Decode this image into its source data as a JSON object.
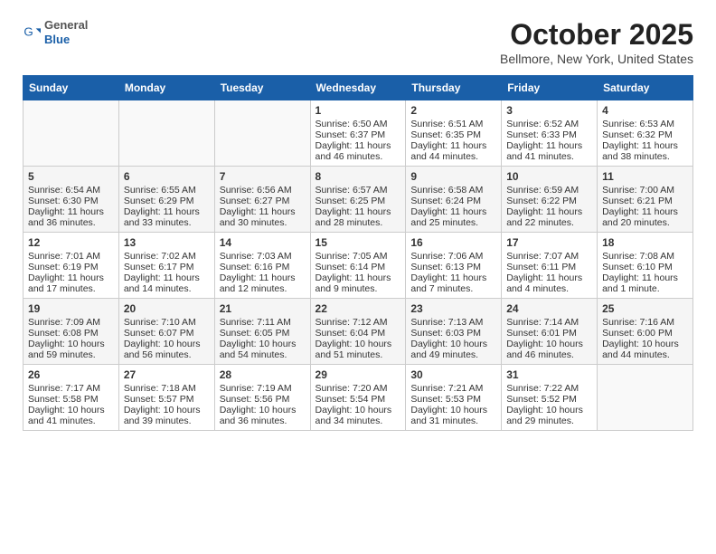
{
  "header": {
    "logo": {
      "general": "General",
      "blue": "Blue"
    },
    "title": "October 2025",
    "location": "Bellmore, New York, United States"
  },
  "days_of_week": [
    "Sunday",
    "Monday",
    "Tuesday",
    "Wednesday",
    "Thursday",
    "Friday",
    "Saturday"
  ],
  "weeks": [
    [
      {
        "day": "",
        "info": ""
      },
      {
        "day": "",
        "info": ""
      },
      {
        "day": "",
        "info": ""
      },
      {
        "day": "1",
        "info": "Sunrise: 6:50 AM\nSunset: 6:37 PM\nDaylight: 11 hours\nand 46 minutes."
      },
      {
        "day": "2",
        "info": "Sunrise: 6:51 AM\nSunset: 6:35 PM\nDaylight: 11 hours\nand 44 minutes."
      },
      {
        "day": "3",
        "info": "Sunrise: 6:52 AM\nSunset: 6:33 PM\nDaylight: 11 hours\nand 41 minutes."
      },
      {
        "day": "4",
        "info": "Sunrise: 6:53 AM\nSunset: 6:32 PM\nDaylight: 11 hours\nand 38 minutes."
      }
    ],
    [
      {
        "day": "5",
        "info": "Sunrise: 6:54 AM\nSunset: 6:30 PM\nDaylight: 11 hours\nand 36 minutes."
      },
      {
        "day": "6",
        "info": "Sunrise: 6:55 AM\nSunset: 6:29 PM\nDaylight: 11 hours\nand 33 minutes."
      },
      {
        "day": "7",
        "info": "Sunrise: 6:56 AM\nSunset: 6:27 PM\nDaylight: 11 hours\nand 30 minutes."
      },
      {
        "day": "8",
        "info": "Sunrise: 6:57 AM\nSunset: 6:25 PM\nDaylight: 11 hours\nand 28 minutes."
      },
      {
        "day": "9",
        "info": "Sunrise: 6:58 AM\nSunset: 6:24 PM\nDaylight: 11 hours\nand 25 minutes."
      },
      {
        "day": "10",
        "info": "Sunrise: 6:59 AM\nSunset: 6:22 PM\nDaylight: 11 hours\nand 22 minutes."
      },
      {
        "day": "11",
        "info": "Sunrise: 7:00 AM\nSunset: 6:21 PM\nDaylight: 11 hours\nand 20 minutes."
      }
    ],
    [
      {
        "day": "12",
        "info": "Sunrise: 7:01 AM\nSunset: 6:19 PM\nDaylight: 11 hours\nand 17 minutes."
      },
      {
        "day": "13",
        "info": "Sunrise: 7:02 AM\nSunset: 6:17 PM\nDaylight: 11 hours\nand 14 minutes."
      },
      {
        "day": "14",
        "info": "Sunrise: 7:03 AM\nSunset: 6:16 PM\nDaylight: 11 hours\nand 12 minutes."
      },
      {
        "day": "15",
        "info": "Sunrise: 7:05 AM\nSunset: 6:14 PM\nDaylight: 11 hours\nand 9 minutes."
      },
      {
        "day": "16",
        "info": "Sunrise: 7:06 AM\nSunset: 6:13 PM\nDaylight: 11 hours\nand 7 minutes."
      },
      {
        "day": "17",
        "info": "Sunrise: 7:07 AM\nSunset: 6:11 PM\nDaylight: 11 hours\nand 4 minutes."
      },
      {
        "day": "18",
        "info": "Sunrise: 7:08 AM\nSunset: 6:10 PM\nDaylight: 11 hours\nand 1 minute."
      }
    ],
    [
      {
        "day": "19",
        "info": "Sunrise: 7:09 AM\nSunset: 6:08 PM\nDaylight: 10 hours\nand 59 minutes."
      },
      {
        "day": "20",
        "info": "Sunrise: 7:10 AM\nSunset: 6:07 PM\nDaylight: 10 hours\nand 56 minutes."
      },
      {
        "day": "21",
        "info": "Sunrise: 7:11 AM\nSunset: 6:05 PM\nDaylight: 10 hours\nand 54 minutes."
      },
      {
        "day": "22",
        "info": "Sunrise: 7:12 AM\nSunset: 6:04 PM\nDaylight: 10 hours\nand 51 minutes."
      },
      {
        "day": "23",
        "info": "Sunrise: 7:13 AM\nSunset: 6:03 PM\nDaylight: 10 hours\nand 49 minutes."
      },
      {
        "day": "24",
        "info": "Sunrise: 7:14 AM\nSunset: 6:01 PM\nDaylight: 10 hours\nand 46 minutes."
      },
      {
        "day": "25",
        "info": "Sunrise: 7:16 AM\nSunset: 6:00 PM\nDaylight: 10 hours\nand 44 minutes."
      }
    ],
    [
      {
        "day": "26",
        "info": "Sunrise: 7:17 AM\nSunset: 5:58 PM\nDaylight: 10 hours\nand 41 minutes."
      },
      {
        "day": "27",
        "info": "Sunrise: 7:18 AM\nSunset: 5:57 PM\nDaylight: 10 hours\nand 39 minutes."
      },
      {
        "day": "28",
        "info": "Sunrise: 7:19 AM\nSunset: 5:56 PM\nDaylight: 10 hours\nand 36 minutes."
      },
      {
        "day": "29",
        "info": "Sunrise: 7:20 AM\nSunset: 5:54 PM\nDaylight: 10 hours\nand 34 minutes."
      },
      {
        "day": "30",
        "info": "Sunrise: 7:21 AM\nSunset: 5:53 PM\nDaylight: 10 hours\nand 31 minutes."
      },
      {
        "day": "31",
        "info": "Sunrise: 7:22 AM\nSunset: 5:52 PM\nDaylight: 10 hours\nand 29 minutes."
      },
      {
        "day": "",
        "info": ""
      }
    ]
  ]
}
